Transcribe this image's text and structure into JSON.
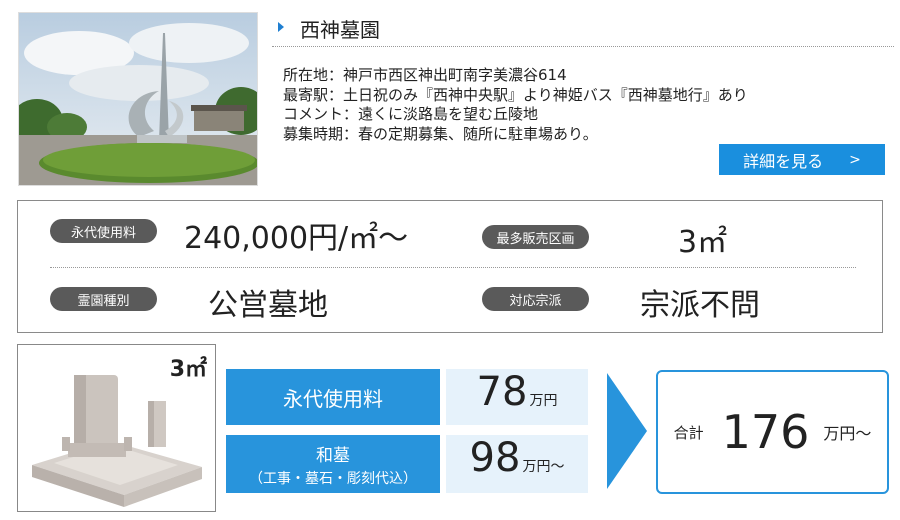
{
  "title": "西神墓園",
  "info_lines": [
    "所在地：神戸市西区神出町南字美濃谷614",
    "最寄駅：土日祝のみ『西神中央駅』より神姫バス『西神墓地行』あり",
    "コメント：遠くに淡路島を望む丘陵地",
    "募集時期：春の定期募集、随所に駐車場あり。"
  ],
  "detail_button": {
    "label": "詳細を見る",
    "chevron": ">"
  },
  "specs": {
    "perpetual_fee": {
      "label": "永代使用料",
      "value": "240,000円/㎡～"
    },
    "max_lot": {
      "label": "最多販売区画",
      "value": "3㎡"
    },
    "cemetery_type": {
      "label": "霊園種別",
      "value": "公営墓地"
    },
    "sect": {
      "label": "対応宗派",
      "value": "宗派不問"
    }
  },
  "grave": {
    "size": "3㎡"
  },
  "pricing": {
    "perpetual": {
      "label": "永代使用料",
      "amount": "78",
      "unit": "万円"
    },
    "wabaka": {
      "label": "和墓",
      "sublabel": "（工事・墓石・彫刻代込）",
      "amount": "98",
      "unit": "万円～"
    },
    "total": {
      "label": "合計",
      "amount": "176",
      "unit": "万円～"
    }
  },
  "colors": {
    "accent_blue": "#2894dc",
    "button_blue": "#1a8fde",
    "pill_gray": "#5a5a5a",
    "price_bg": "#e6f2fb"
  }
}
